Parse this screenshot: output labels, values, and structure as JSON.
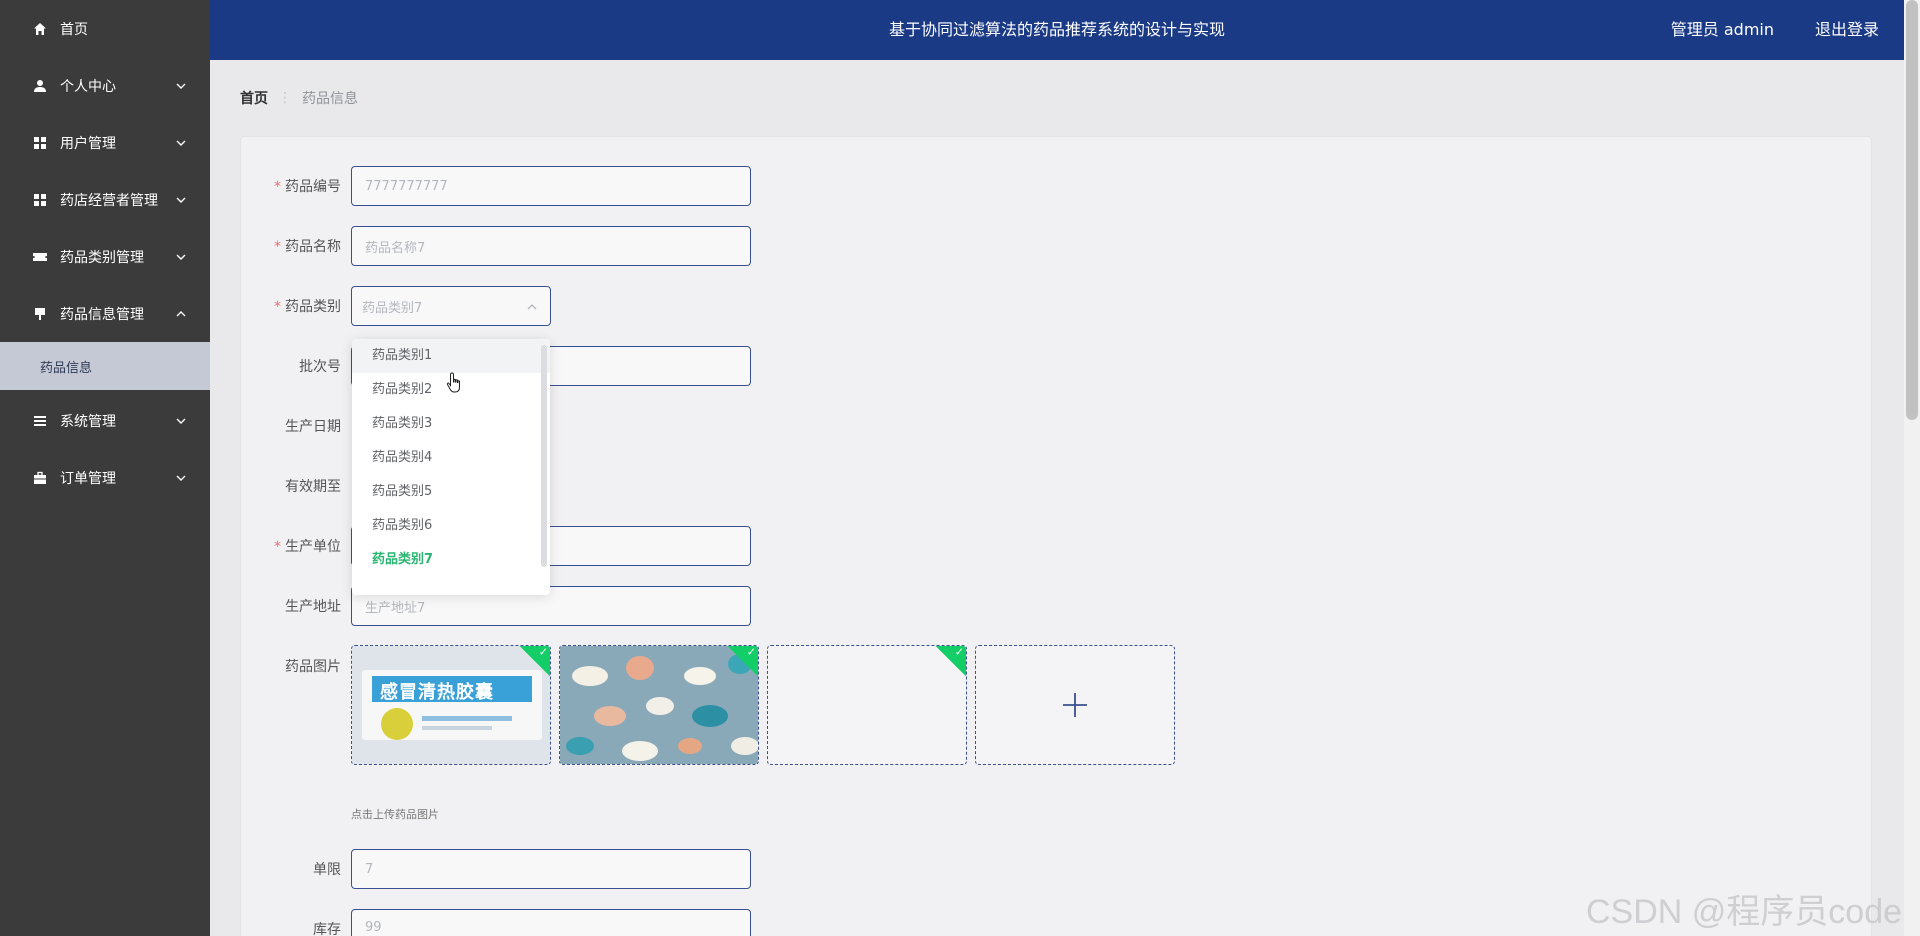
{
  "sidebar": {
    "items": [
      {
        "label": "首页",
        "icon": "home-icon"
      },
      {
        "label": "个人中心",
        "icon": "user-icon"
      },
      {
        "label": "用户管理",
        "icon": "grid-icon"
      },
      {
        "label": "药店经营者管理",
        "icon": "grid-icon"
      },
      {
        "label": "药品类别管理",
        "icon": "ticket-icon"
      },
      {
        "label": "药品信息管理",
        "icon": "sign-icon"
      },
      {
        "label": "系统管理",
        "icon": "list-icon"
      },
      {
        "label": "订单管理",
        "icon": "briefcase-icon"
      }
    ],
    "active_submenu": "药品信息"
  },
  "header": {
    "title": "基于协同过滤算法的药品推荐系统的设计与实现",
    "user": "管理员 admin",
    "logout": "退出登录"
  },
  "breadcrumb": {
    "home": "首页",
    "current": "药品信息"
  },
  "form": {
    "code_label": "药品编号",
    "code_value": "7777777777",
    "name_label": "药品名称",
    "name_placeholder": "药品名称7",
    "category_label": "药品类别",
    "category_value": "药品类别7",
    "batch_label": "批次号",
    "prod_date_label": "生产日期",
    "expiry_label": "有效期至",
    "manufacturer_label": "生产单位",
    "address_label": "生产地址",
    "address_placeholder": "生产地址7",
    "image_label": "药品图片",
    "image_hint": "点击上传药品图片",
    "limit_label": "单限",
    "limit_value": "7",
    "stock_label": "库存",
    "stock_value": "99"
  },
  "dropdown": {
    "options": [
      "药品类别1",
      "药品类别2",
      "药品类别3",
      "药品类别4",
      "药品类别5",
      "药品类别6",
      "药品类别7"
    ],
    "hovered": "药品类别1",
    "selected": "药品类别7"
  },
  "images": {
    "tile1_text": "感冒清热胶囊"
  },
  "watermark": "CSDN @程序员code",
  "colors": {
    "header_bg": "#1a3a86",
    "sidebar_bg": "#3b3b3b",
    "selected_green": "#2bb673",
    "required_red": "#f56c6c"
  }
}
